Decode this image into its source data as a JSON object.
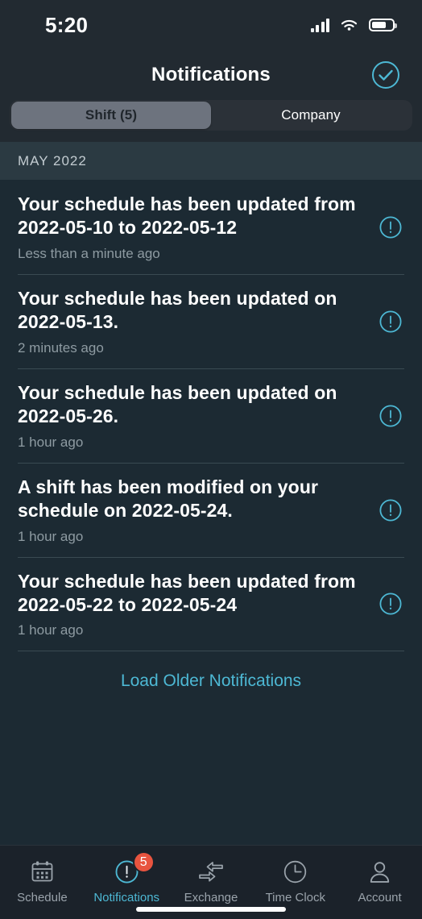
{
  "status_bar": {
    "time": "5:20",
    "signal_icon": "cellular-signal-icon",
    "wifi_icon": "wifi-icon",
    "battery_icon": "battery-icon"
  },
  "header": {
    "title": "Notifications",
    "action_icon": "check-circle-icon"
  },
  "segmented_control": {
    "options": [
      {
        "label": "Shift (5)",
        "selected": true
      },
      {
        "label": "Company",
        "selected": false
      }
    ]
  },
  "section": {
    "label": "MAY 2022"
  },
  "notifications": [
    {
      "title": "Your schedule has been updated from 2022-05-10 to 2022-05-12",
      "time": "Less than a minute ago",
      "icon": "alert-circle-icon"
    },
    {
      "title": "Your schedule has been updated on 2022-05-13.",
      "time": "2 minutes ago",
      "icon": "alert-circle-icon"
    },
    {
      "title": "Your schedule has been updated on 2022-05-26.",
      "time": "1 hour ago",
      "icon": "alert-circle-icon"
    },
    {
      "title": "A shift has been modified on your schedule on 2022-05-24.",
      "time": "1 hour ago",
      "icon": "alert-circle-icon"
    },
    {
      "title": "Your schedule has been updated from 2022-05-22 to 2022-05-24",
      "time": "1 hour ago",
      "icon": "alert-circle-icon"
    }
  ],
  "load_more": {
    "label": "Load Older Notifications"
  },
  "tab_bar": {
    "tabs": [
      {
        "label": "Schedule",
        "icon": "calendar-icon",
        "active": false
      },
      {
        "label": "Notifications",
        "icon": "alert-circle-icon",
        "active": true,
        "badge": "5"
      },
      {
        "label": "Exchange",
        "icon": "swap-arrows-icon",
        "active": false
      },
      {
        "label": "Time Clock",
        "icon": "clock-icon",
        "active": false
      },
      {
        "label": "Account",
        "icon": "person-icon",
        "active": false
      }
    ]
  },
  "colors": {
    "accent": "#4db8d4",
    "badge": "#e8543f",
    "background": "#1c2a33",
    "header_background": "#222a31",
    "section_background": "#2b3a42",
    "tabbar_background": "#1b222a",
    "muted_text": "#8e9ba2"
  }
}
